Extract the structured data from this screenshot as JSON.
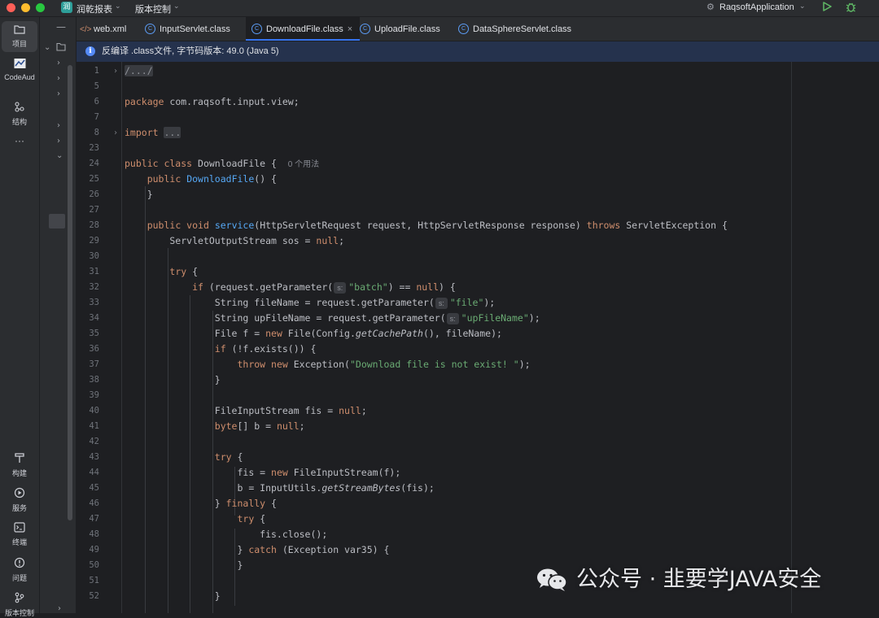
{
  "window": {
    "project_badge": "润",
    "project_name": "润乾报表",
    "vcs_menu": "版本控制",
    "run_config": "RaqsoftApplication"
  },
  "left_toolbar": {
    "top": [
      {
        "label": "项目",
        "icon": "folder-icon"
      },
      {
        "label": "CodeAud",
        "icon": "codeaudit-icon"
      },
      {
        "label": "结构",
        "icon": "structure-icon"
      },
      {
        "label": "···",
        "icon": "more-icon"
      }
    ],
    "bottom": [
      {
        "label": "构建",
        "icon": "hammer-icon"
      },
      {
        "label": "服务",
        "icon": "services-icon"
      },
      {
        "label": "终端",
        "icon": "terminal-icon"
      },
      {
        "label": "问题",
        "icon": "problems-icon"
      },
      {
        "label": "版本控制",
        "icon": "vcs-icon"
      }
    ]
  },
  "tabs": [
    {
      "label": "web.xml",
      "icon": "xml-file-icon",
      "active": false
    },
    {
      "label": "InputServlet.class",
      "icon": "class-file-icon",
      "active": false
    },
    {
      "label": "DownloadFile.class",
      "icon": "class-file-icon",
      "active": true
    },
    {
      "label": "UploadFile.class",
      "icon": "class-file-icon",
      "active": false
    },
    {
      "label": "DataSphereServlet.class",
      "icon": "class-file-icon",
      "active": false
    }
  ],
  "banner": {
    "text": "反编译 .class文件, 字节码版本: 49.0 (Java 5)"
  },
  "editor": {
    "line_numbers": [
      "1",
      "5",
      "6",
      "7",
      "8",
      "23",
      "24",
      "25",
      "26",
      "27",
      "28",
      "29",
      "30",
      "31",
      "32",
      "33",
      "34",
      "35",
      "36",
      "37",
      "38",
      "39",
      "40",
      "41",
      "42",
      "43",
      "44",
      "45",
      "46",
      "47",
      "48",
      "49",
      "50",
      "51",
      "52"
    ],
    "usage_hint": "0 个用法",
    "param_hint": "s:",
    "collapsed_import": "...",
    "collapsed_header": "/.../"
  },
  "watermark": {
    "text": "公众号 · 韭要学JAVA安全"
  },
  "colors": {
    "background": "#1e1f22",
    "keyword": "#cf8e6d",
    "string": "#6aab73",
    "function": "#56a8f5",
    "accent": "#3574f0"
  }
}
